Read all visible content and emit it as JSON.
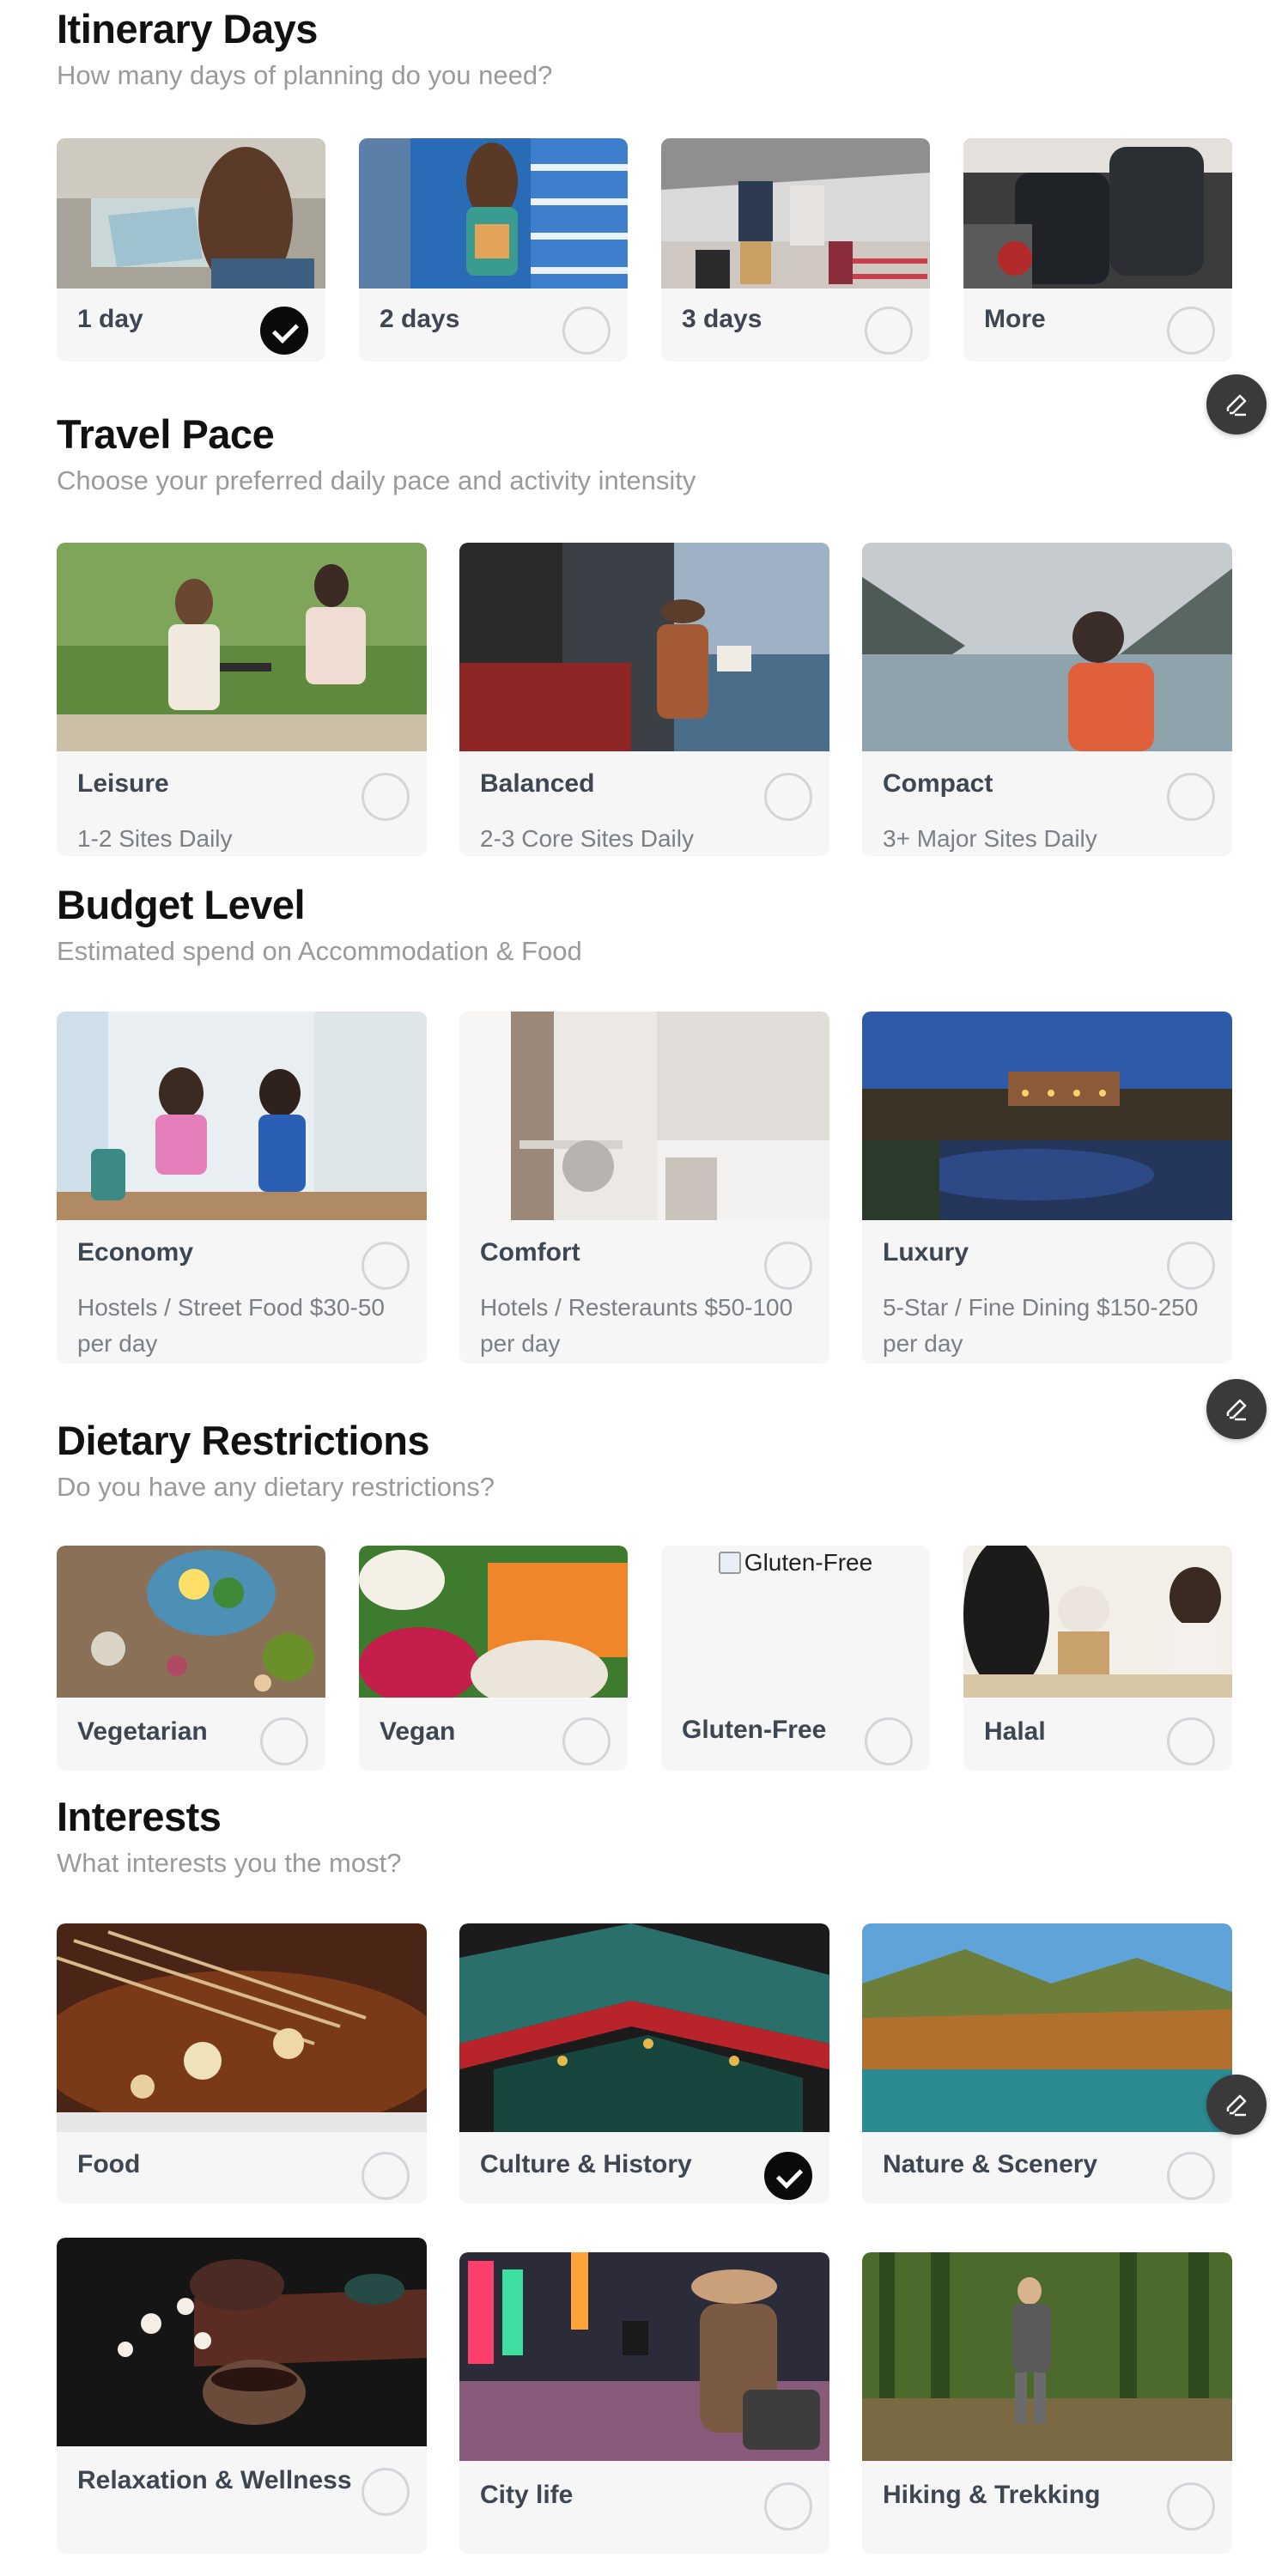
{
  "itinerary": {
    "title": "Itinerary Days",
    "subtitle": "How many days of planning do you need?",
    "options": [
      {
        "label": "1 day",
        "selected": true
      },
      {
        "label": "2 days",
        "selected": false
      },
      {
        "label": "3 days",
        "selected": false
      },
      {
        "label": "More",
        "selected": false
      }
    ]
  },
  "pace": {
    "title": "Travel Pace",
    "subtitle": "Choose your preferred daily pace and activity intensity",
    "options": [
      {
        "label": "Leisure",
        "desc": "1-2 Sites Daily",
        "selected": false
      },
      {
        "label": "Balanced",
        "desc": "2-3 Core Sites Daily",
        "selected": false
      },
      {
        "label": "Compact",
        "desc": "3+ Major Sites Daily",
        "selected": false
      }
    ]
  },
  "budget": {
    "title": "Budget Level",
    "subtitle": "Estimated spend on Accommodation & Food",
    "options": [
      {
        "label": "Economy",
        "desc": "Hostels / Street Food $30-50 per day",
        "selected": false
      },
      {
        "label": "Comfort",
        "desc": "Hotels / Resteraunts $50-100 per day",
        "selected": false
      },
      {
        "label": "Luxury",
        "desc": "5-Star / Fine Dining $150-250 per day",
        "selected": false
      }
    ]
  },
  "dietary": {
    "title": "Dietary Restrictions",
    "subtitle": "Do you have any dietary restrictions?",
    "options": [
      {
        "label": "Vegetarian",
        "selected": false
      },
      {
        "label": "Vegan",
        "selected": false
      },
      {
        "label": "Gluten-Free",
        "selected": false,
        "alt": "Gluten-Free"
      },
      {
        "label": "Halal",
        "selected": false
      }
    ]
  },
  "interests": {
    "title": "Interests",
    "subtitle": "What interests you the most?",
    "options": [
      {
        "label": "Food",
        "selected": false
      },
      {
        "label": "Culture & History",
        "selected": true
      },
      {
        "label": "Nature & Scenery",
        "selected": false
      },
      {
        "label": "Relaxation & Wellness",
        "selected": false
      },
      {
        "label": "City life",
        "selected": false
      },
      {
        "label": "Hiking & Trekking",
        "selected": false
      }
    ]
  },
  "icons": {
    "edit": "pencil-icon",
    "check": "checkmark-icon"
  },
  "colors": {
    "card_bg": "#f6f6f7",
    "checked": "#0b0b0b",
    "edit_button": "#3a3a3a"
  }
}
